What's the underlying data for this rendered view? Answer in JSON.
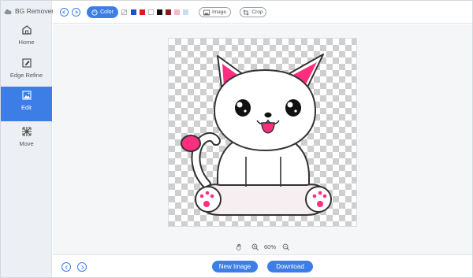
{
  "app": {
    "title": "BG Remover"
  },
  "sidebar": {
    "items": [
      {
        "label": "Home",
        "icon": "home-icon",
        "active": false
      },
      {
        "label": "Edge Refine",
        "icon": "edit-pencil-icon",
        "active": false
      },
      {
        "label": "Edit",
        "icon": "image-edit-icon",
        "active": true
      },
      {
        "label": "Move",
        "icon": "move-arrows-icon",
        "active": false
      }
    ]
  },
  "toolbar": {
    "undo_icon": "undo-icon",
    "redo_icon": "redo-icon",
    "color_label": "Color",
    "swatches": [
      "#1a4fd6",
      "#e4181d",
      "#ffffff",
      "#111111",
      "#8d1b1b",
      "#f4b8c4",
      "#c9dcf4"
    ],
    "image_label": "Image",
    "crop_label": "Crop"
  },
  "zoom": {
    "value": "60%"
  },
  "bottom": {
    "new_image_label": "New Image",
    "download_label": "Download"
  },
  "colors": {
    "accent": "#3d7ee6",
    "sidebar_bg": "#eceff3",
    "canvas_bg": "#f4f6f8",
    "cat_pink": "#ff2e7e"
  }
}
